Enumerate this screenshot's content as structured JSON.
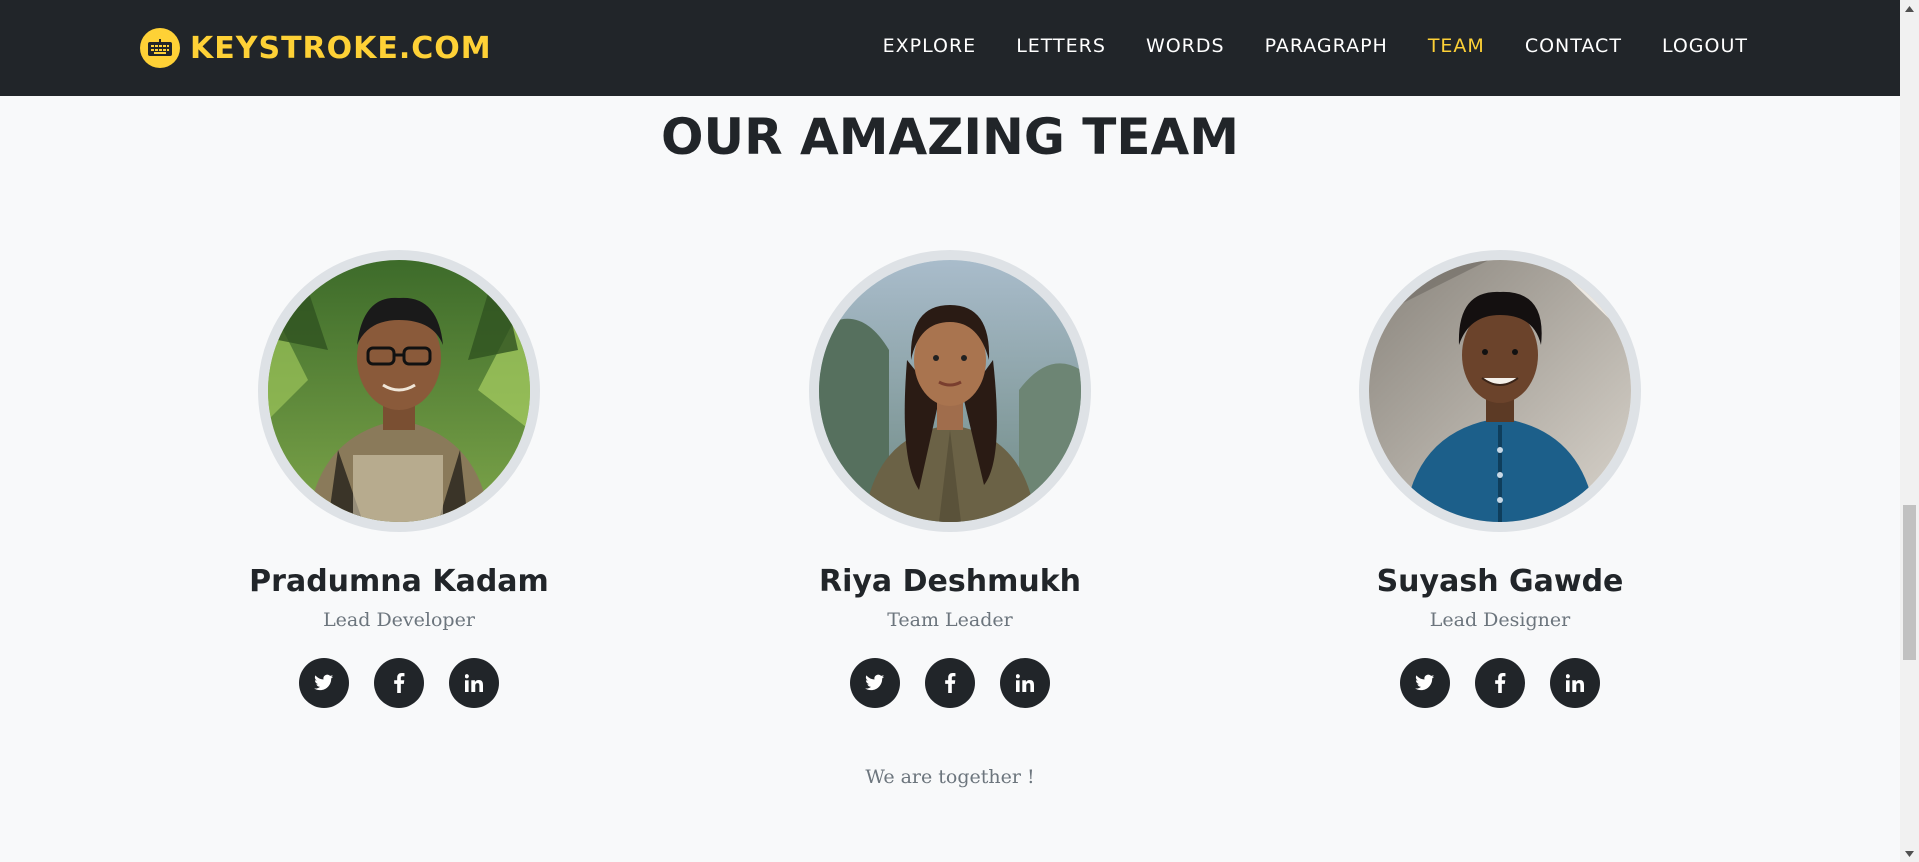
{
  "navbar": {
    "brand": "KEYSTROKE.COM",
    "brand_color": "#fed136",
    "logo_icon": "keyboard-icon",
    "links": [
      {
        "label": "EXPLORE",
        "active": false
      },
      {
        "label": "LETTERS",
        "active": false
      },
      {
        "label": "WORDS",
        "active": false
      },
      {
        "label": "PARAGRAPH",
        "active": false
      },
      {
        "label": "TEAM",
        "active": true
      },
      {
        "label": "CONTACT",
        "active": false
      },
      {
        "label": "LOGOUT",
        "active": false
      }
    ]
  },
  "team": {
    "title": "OUR AMAZING TEAM",
    "members": [
      {
        "name": "Pradumna Kadam",
        "role": "Lead Developer",
        "socials": [
          "twitter-icon",
          "facebook-icon",
          "linkedin-icon"
        ]
      },
      {
        "name": "Riya Deshmukh",
        "role": "Team Leader",
        "socials": [
          "twitter-icon",
          "facebook-icon",
          "linkedin-icon"
        ]
      },
      {
        "name": "Suyash Gawde",
        "role": "Lead Designer",
        "socials": [
          "twitter-icon",
          "facebook-icon",
          "linkedin-icon"
        ]
      }
    ],
    "footnote": "We are together !"
  },
  "colors": {
    "navbar_bg": "#212529",
    "accent": "#fed136",
    "page_bg": "#f8f9fa",
    "muted_text": "#6c757d"
  }
}
